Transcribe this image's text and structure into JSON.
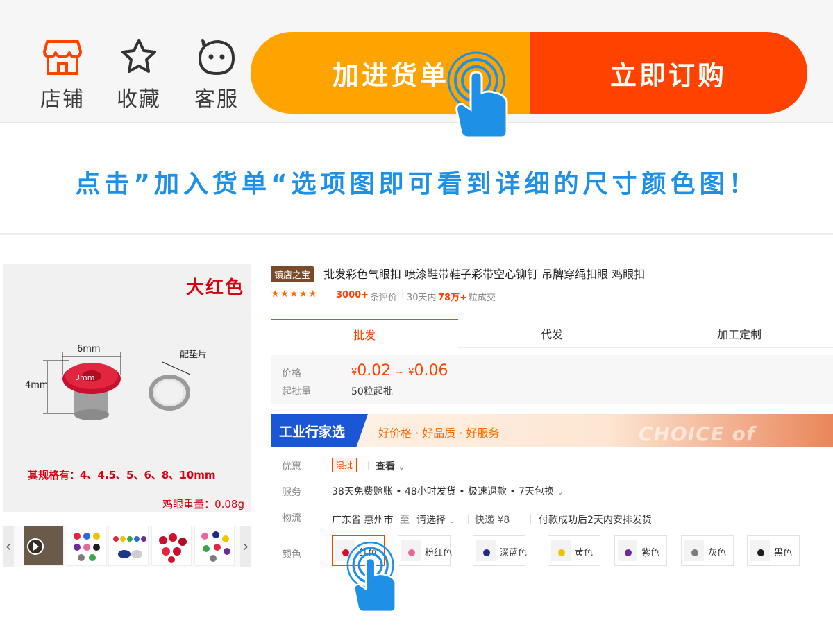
{
  "topbar": {
    "store_label": "店铺",
    "favorite_label": "收藏",
    "service_label": "客服",
    "add_cart_label": "加进货单",
    "buy_now_label": "立即订购"
  },
  "instruction": "点击”加入货单“选项图即可看到详细的尺寸颜色图！",
  "product_image": {
    "color_title": "大红色",
    "dim_width": "6mm",
    "dim_height": "4mm",
    "dim_inner": "3mm",
    "washer_label": "配垫片",
    "spec_text": "其规格有：4、4.5、5、6、8、10mm",
    "weight_text": "鸡眼重量：0.08g"
  },
  "product": {
    "badge": "镇店之宝",
    "title": "批发彩色气眼扣 喷漆鞋带鞋子彩带空心铆钉 吊牌穿绳扣眼 鸡眼扣",
    "review_count": "3000+",
    "review_label": "条评价",
    "sold_label": "30天内",
    "sold_count": "78万+",
    "sold_unit": "粒成交"
  },
  "tabs": [
    "批发",
    "代发",
    "加工定制"
  ],
  "price": {
    "price_label": "价格",
    "moq_label": "起批量",
    "currency": "¥",
    "low": "0.02",
    "tilde": "~",
    "high": "0.06",
    "moq_value": "50粒起批"
  },
  "banner": {
    "tag": "工业行家选",
    "text": "好价格 · 好品质 · 好服务",
    "watermark": "CHOICE of EXPERT"
  },
  "rows": {
    "promo_label": "优惠",
    "promo_tag": "混批",
    "promo_link": "查看",
    "service_label": "服务",
    "service_value": "38天免费赊账 • 48小时发货 • 极速退款 • 7天包换",
    "logistics_label": "物流",
    "origin": "广东省 惠州市",
    "to": "至",
    "select": "请选择",
    "express": "快递 ¥8",
    "ship_note": "付款成功后2天内安排发货",
    "color_label": "颜色"
  },
  "colors": [
    {
      "label": "红色",
      "dot": "#d7102a"
    },
    {
      "label": "粉红色",
      "dot": "#e8679b"
    },
    {
      "label": "深蓝色",
      "dot": "#1c2a8a"
    },
    {
      "label": "黄色",
      "dot": "#f2c200"
    },
    {
      "label": "紫色",
      "dot": "#6b2b9c"
    },
    {
      "label": "灰色",
      "dot": "#7d7d7d"
    },
    {
      "label": "黑色",
      "dot": "#1d1d1d"
    }
  ],
  "accent": {
    "orange": "#fea400",
    "red": "#ff4200",
    "blue": "#1e90e6"
  }
}
